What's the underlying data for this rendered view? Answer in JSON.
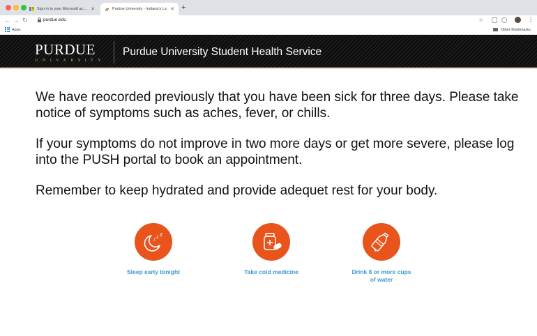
{
  "browser": {
    "tabs": [
      {
        "title": "Sign in to your Microsoft accoun"
      },
      {
        "title": "Purdue University - Indiana's La"
      }
    ],
    "new_tab": "+",
    "url": "purdue.edu",
    "bookmarks": {
      "apps": "Apps",
      "other": "Other Bookmarks"
    }
  },
  "header": {
    "logo_word": "PURDUE",
    "logo_sub": "UNIVERSITY",
    "title": "Purdue University Student Health Service"
  },
  "main": {
    "paragraphs": [
      "We have reocorded previously that you have been sick for three days. Please take notice of symptoms such as aches, fever, or chills.",
      "If your symptoms do not improve in two more days or get more severe, please log into the PUSH portal to book an appointment.",
      "Remember to keep hydrated and provide adequet rest for your body."
    ]
  },
  "tips": [
    {
      "label": "Sleep early tonight",
      "icon": "moon-sleep-icon"
    },
    {
      "label": "Take cold medicine",
      "icon": "medicine-icon"
    },
    {
      "label": "Drink 8 or more cups of water",
      "icon": "water-bottle-icon"
    }
  ],
  "colors": {
    "accent": "#e8541c",
    "tip_label": "#3d9ad1",
    "gold": "#c8a45a"
  }
}
